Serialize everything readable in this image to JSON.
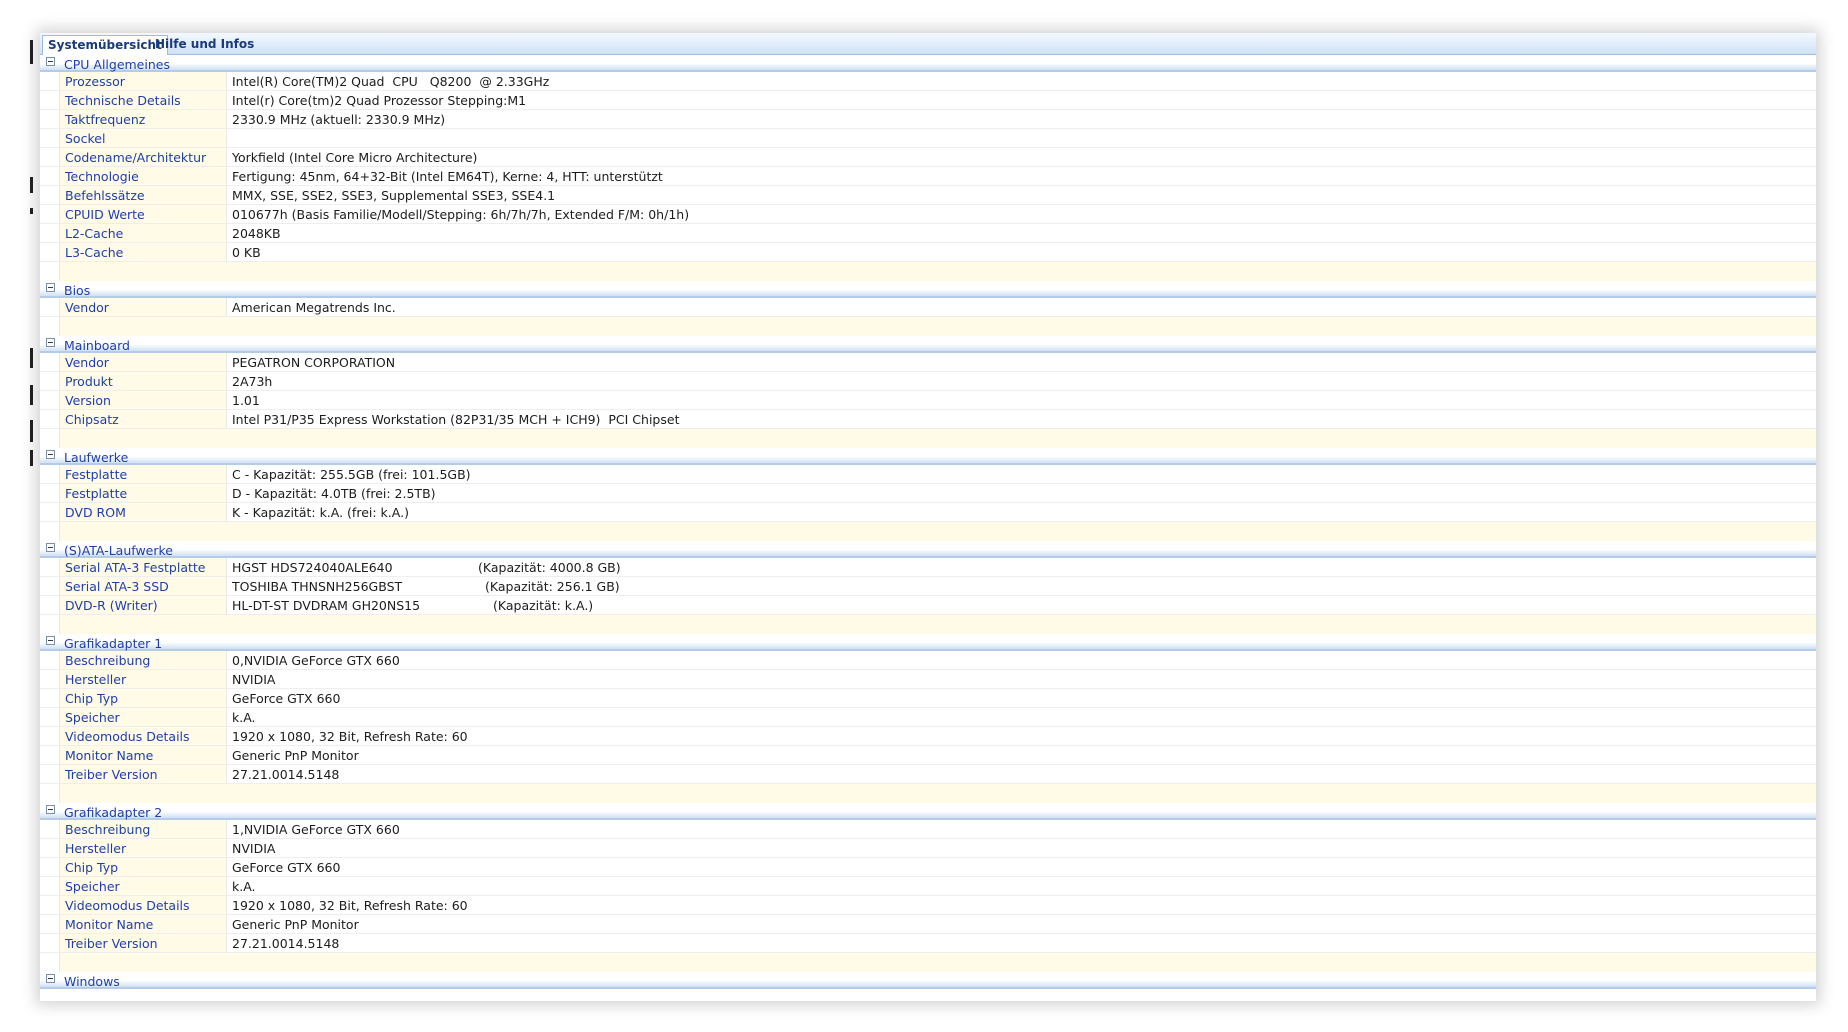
{
  "tabs": [
    {
      "label": "Systemübersicht",
      "active": true
    },
    {
      "label": "Hilfe und Infos",
      "active": false
    }
  ],
  "sections": [
    {
      "title": "CPU Allgemeines",
      "rows": [
        {
          "key": "Prozessor",
          "value": "Intel(R) Core(TM)2 Quad  CPU   Q8200  @ 2.33GHz"
        },
        {
          "key": "Technische Details",
          "value": "Intel(r) Core(tm)2 Quad Prozessor Stepping:M1"
        },
        {
          "key": "Taktfrequenz",
          "value": "2330.9 MHz (aktuell: 2330.9 MHz)"
        },
        {
          "key": "Sockel",
          "value": ""
        },
        {
          "key": "Codename/Architektur",
          "value": "Yorkfield (Intel Core Micro Architecture)"
        },
        {
          "key": "Technologie",
          "value": "Fertigung: 45nm, 64+32-Bit (Intel EM64T), Kerne: 4, HTT: unterstützt"
        },
        {
          "key": "Befehlssätze",
          "value": "MMX, SSE, SSE2, SSE3, Supplemental SSE3, SSE4.1"
        },
        {
          "key": "CPUID Werte",
          "value": "010677h (Basis Familie/Modell/Stepping: 6h/7h/7h, Extended F/M: 0h/1h)"
        },
        {
          "key": "L2-Cache",
          "value": "2048KB"
        },
        {
          "key": "L3-Cache",
          "value": "0 KB"
        }
      ]
    },
    {
      "title": "Bios",
      "rows": [
        {
          "key": "Vendor",
          "value": "American Megatrends Inc."
        }
      ]
    },
    {
      "title": "Mainboard",
      "rows": [
        {
          "key": "Vendor",
          "value": "PEGATRON CORPORATION"
        },
        {
          "key": "Produkt",
          "value": "2A73h"
        },
        {
          "key": "Version",
          "value": "1.01"
        },
        {
          "key": "Chipsatz",
          "value": "Intel P31/P35 Express Workstation (82P31/35 MCH + ICH9)  PCI Chipset"
        }
      ]
    },
    {
      "title": "Laufwerke",
      "rows": [
        {
          "key": "Festplatte",
          "value": "C - Kapazität: 255.5GB (frei: 101.5GB)"
        },
        {
          "key": "Festplatte",
          "value": "D - Kapazität: 4.0TB (frei: 2.5TB)"
        },
        {
          "key": "DVD ROM",
          "value": "K - Kapazität: k.A. (frei: k.A.)"
        }
      ]
    },
    {
      "title": "(S)ATA-Laufwerke",
      "rows": [
        {
          "key": "Serial ATA-3 Festplatte",
          "value": "HGST HDS724040ALE640",
          "capacity": "(Kapazität: 4000.8 GB)"
        },
        {
          "key": "Serial ATA-3 SSD",
          "value": "TOSHIBA THNSNH256GBST",
          "capacity": "(Kapazität: 256.1 GB)"
        },
        {
          "key": "DVD-R (Writer)",
          "value": "HL-DT-ST DVDRAM GH20NS15",
          "capacity": "(Kapazität: k.A.)"
        }
      ]
    },
    {
      "title": "Grafikadapter 1",
      "rows": [
        {
          "key": "Beschreibung",
          "value": "0,NVIDIA GeForce GTX 660"
        },
        {
          "key": "Hersteller",
          "value": "NVIDIA"
        },
        {
          "key": "Chip Typ",
          "value": "GeForce GTX 660"
        },
        {
          "key": "Speicher",
          "value": "k.A."
        },
        {
          "key": "Videomodus Details",
          "value": "1920 x 1080, 32 Bit, Refresh Rate: 60"
        },
        {
          "key": "Monitor Name",
          "value": "Generic PnP Monitor"
        },
        {
          "key": "Treiber Version",
          "value": "27.21.0014.5148"
        }
      ]
    },
    {
      "title": "Grafikadapter 2",
      "rows": [
        {
          "key": "Beschreibung",
          "value": "1,NVIDIA GeForce GTX 660"
        },
        {
          "key": "Hersteller",
          "value": "NVIDIA"
        },
        {
          "key": "Chip Typ",
          "value": "GeForce GTX 660"
        },
        {
          "key": "Speicher",
          "value": "k.A."
        },
        {
          "key": "Videomodus Details",
          "value": "1920 x 1080, 32 Bit, Refresh Rate: 60"
        },
        {
          "key": "Monitor Name",
          "value": "Generic PnP Monitor"
        },
        {
          "key": "Treiber Version",
          "value": "27.21.0014.5148"
        }
      ]
    },
    {
      "title": "Windows",
      "rows": []
    }
  ]
}
